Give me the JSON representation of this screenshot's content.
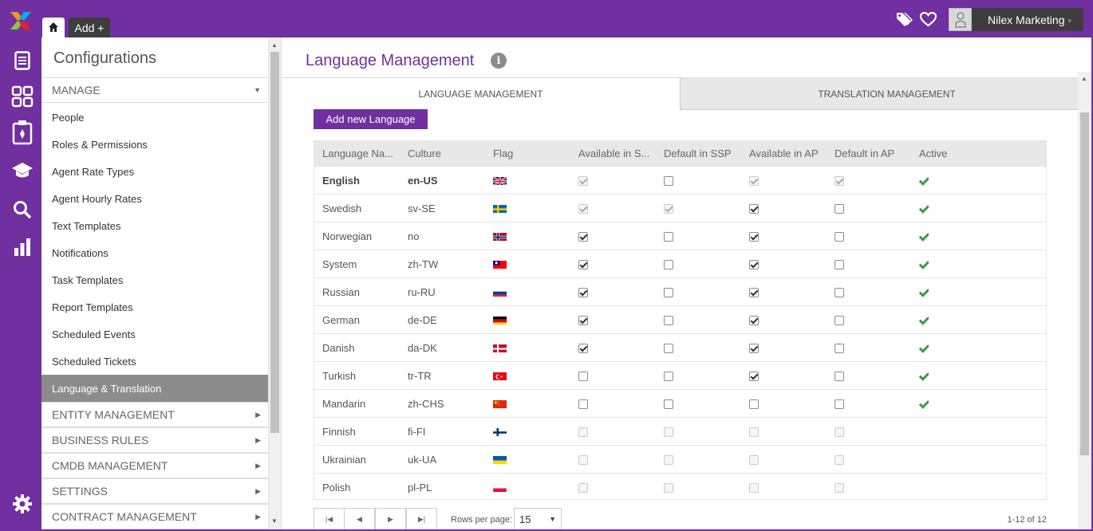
{
  "header": {
    "home_tab_icon": "home-icon",
    "add_tab_label": "Add +",
    "user_name": "Nilex Marketing",
    "tag_icon": "tag-icon",
    "heart_icon": "heart-icon",
    "brand_color": "#7030a0"
  },
  "iconbar": {
    "items": [
      "document-icon",
      "grid-icon",
      "clipboard-icon",
      "graduation-cap-icon",
      "search-icon",
      "bar-chart-icon",
      "gear-icon"
    ]
  },
  "config": {
    "title": "Configurations",
    "manage_label": "MANAGE",
    "items": [
      {
        "label": "People"
      },
      {
        "label": "Roles & Permissions"
      },
      {
        "label": "Agent Rate Types"
      },
      {
        "label": "Agent Hourly Rates"
      },
      {
        "label": "Text Templates"
      },
      {
        "label": "Notifications"
      },
      {
        "label": "Task Templates"
      },
      {
        "label": "Report Templates"
      },
      {
        "label": "Scheduled Events"
      },
      {
        "label": "Scheduled Tickets"
      },
      {
        "label": "Language & Translation"
      }
    ],
    "active_item": "Language & Translation",
    "sections": [
      {
        "label": "ENTITY MANAGEMENT"
      },
      {
        "label": "BUSINESS RULES"
      },
      {
        "label": "CMDB MANAGEMENT"
      },
      {
        "label": "SETTINGS"
      },
      {
        "label": "CONTRACT MANAGEMENT"
      }
    ]
  },
  "main": {
    "title": "Language Management",
    "tabs": [
      {
        "label": "LANGUAGE MANAGEMENT",
        "active": true
      },
      {
        "label": "TRANSLATION MANAGEMENT",
        "active": false
      }
    ],
    "add_button": "Add new Language",
    "columns": [
      "Language Na...",
      "Culture",
      "Flag",
      "Available in S...",
      "Default in SSP",
      "Available in AP",
      "Default in AP",
      "Active"
    ],
    "rows": [
      {
        "name": "English",
        "culture": "en-US",
        "flag": "gb-flag-icon",
        "avail_ssp": "checked-disabled",
        "default_ssp": "unchecked",
        "avail_ap": "checked-disabled",
        "default_ap": "checked-disabled",
        "active": true,
        "bold": true
      },
      {
        "name": "Swedish",
        "culture": "sv-SE",
        "flag": "se-flag-icon",
        "avail_ssp": "checked-disabled",
        "default_ssp": "checked-disabled",
        "avail_ap": "checked",
        "default_ap": "unchecked",
        "active": true
      },
      {
        "name": "Norwegian",
        "culture": "no",
        "flag": "no-flag-icon",
        "avail_ssp": "checked",
        "default_ssp": "unchecked",
        "avail_ap": "checked",
        "default_ap": "unchecked",
        "active": true
      },
      {
        "name": "System",
        "culture": "zh-TW",
        "flag": "tw-flag-icon",
        "avail_ssp": "checked",
        "default_ssp": "unchecked",
        "avail_ap": "checked",
        "default_ap": "unchecked",
        "active": true
      },
      {
        "name": "Russian",
        "culture": "ru-RU",
        "flag": "ru-flag-icon",
        "avail_ssp": "checked",
        "default_ssp": "unchecked",
        "avail_ap": "checked",
        "default_ap": "unchecked",
        "active": true
      },
      {
        "name": "German",
        "culture": "de-DE",
        "flag": "de-flag-icon",
        "avail_ssp": "checked",
        "default_ssp": "unchecked",
        "avail_ap": "checked",
        "default_ap": "unchecked",
        "active": true
      },
      {
        "name": "Danish",
        "culture": "da-DK",
        "flag": "dk-flag-icon",
        "avail_ssp": "checked",
        "default_ssp": "unchecked",
        "avail_ap": "checked",
        "default_ap": "unchecked",
        "active": true
      },
      {
        "name": "Turkish",
        "culture": "tr-TR",
        "flag": "tr-flag-icon",
        "avail_ssp": "unchecked",
        "default_ssp": "unchecked",
        "avail_ap": "checked",
        "default_ap": "unchecked",
        "active": true
      },
      {
        "name": "Mandarin",
        "culture": "zh-CHS",
        "flag": "cn-flag-icon",
        "avail_ssp": "unchecked",
        "default_ssp": "unchecked",
        "avail_ap": "unchecked",
        "default_ap": "unchecked",
        "active": true
      },
      {
        "name": "Finnish",
        "culture": "fi-FI",
        "flag": "fi-flag-icon",
        "avail_ssp": "unchecked-disabled",
        "default_ssp": "unchecked-disabled",
        "avail_ap": "unchecked-disabled",
        "default_ap": "unchecked-disabled",
        "active": false
      },
      {
        "name": "Ukrainian",
        "culture": "uk-UA",
        "flag": "ua-flag-icon",
        "avail_ssp": "unchecked-disabled",
        "default_ssp": "unchecked-disabled",
        "avail_ap": "unchecked-disabled",
        "default_ap": "unchecked-disabled",
        "active": false
      },
      {
        "name": "Polish",
        "culture": "pl-PL",
        "flag": "pl-flag-icon",
        "avail_ssp": "unchecked-disabled",
        "default_ssp": "unchecked-disabled",
        "avail_ap": "unchecked-disabled",
        "default_ap": "unchecked-disabled",
        "active": false
      }
    ],
    "pager": {
      "rows_per_page_label": "Rows per page:",
      "rows_per_page": "15",
      "range": "1-12 of 12"
    }
  }
}
